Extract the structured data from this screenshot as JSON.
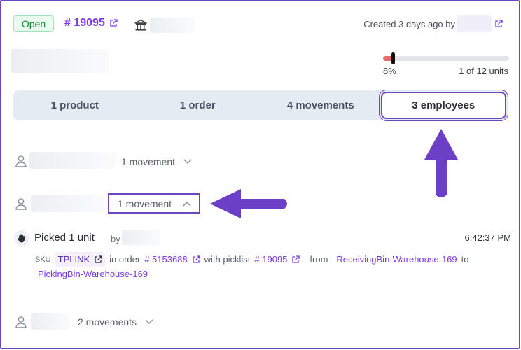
{
  "header": {
    "status": "Open",
    "order_number": "# 19095",
    "created_text": "Created 3 days ago by"
  },
  "progress": {
    "percent_label": "8%",
    "percent_value": 8,
    "units_label": "1 of 12 units"
  },
  "tabs": [
    {
      "label": "1 product"
    },
    {
      "label": "1 order"
    },
    {
      "label": "4 movements"
    },
    {
      "label": "3 employees",
      "active": true
    }
  ],
  "employees": [
    {
      "movements_label": "1 movement",
      "expanded": false
    },
    {
      "movements_label": "1 movement",
      "expanded": true
    },
    {
      "movements_label": "2 movements",
      "expanded": false
    }
  ],
  "movement": {
    "action": "Picked 1 unit",
    "by": "by",
    "time": "6:42:37 PM",
    "sku_label": "SKU",
    "sku": "TPLINK",
    "in_order": "in order",
    "order_ref": "# 5153688",
    "with_picklist": "with picklist",
    "picklist_ref": "# 19095",
    "from": "from",
    "from_bin": "ReceivingBin-Warehouse-169",
    "to": "to",
    "to_bin": "PickingBin-Warehouse-169"
  },
  "colors": {
    "accent": "#6b46c1",
    "link": "#7c3aed",
    "open_green": "#1c8b3f",
    "progress_red": "#e86b6b"
  }
}
